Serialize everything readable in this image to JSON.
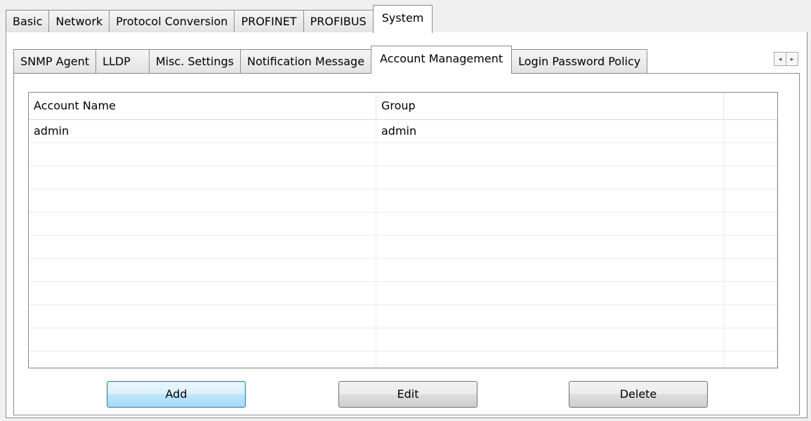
{
  "top_tabs": [
    "Basic",
    "Network",
    "Protocol Conversion",
    "PROFINET",
    "PROFIBUS",
    "System"
  ],
  "sub_tabs": [
    "SNMP Agent",
    "LLDP",
    "Misc. Settings",
    "Notification Message",
    "Account Management",
    "Login Password Policy"
  ],
  "scroll_left": "◂",
  "scroll_right": "▸",
  "table": {
    "headers": [
      "Account Name",
      "Group",
      ""
    ],
    "rows": [
      [
        "admin",
        "admin",
        ""
      ],
      [
        "",
        "",
        ""
      ],
      [
        "",
        "",
        ""
      ],
      [
        "",
        "",
        ""
      ],
      [
        "",
        "",
        ""
      ],
      [
        "",
        "",
        ""
      ],
      [
        "",
        "",
        ""
      ],
      [
        "",
        "",
        ""
      ],
      [
        "",
        "",
        ""
      ],
      [
        "",
        "",
        ""
      ],
      [
        "",
        "",
        ""
      ]
    ]
  },
  "buttons": {
    "add": "Add",
    "edit": "Edit",
    "delete": "Delete"
  }
}
